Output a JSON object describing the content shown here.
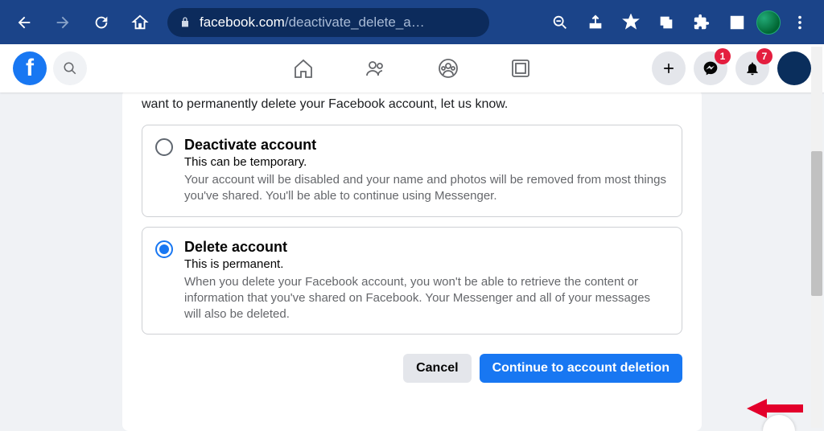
{
  "browser": {
    "url_domain": "facebook.com",
    "url_path": "/deactivate_delete_a…"
  },
  "fbnav": {
    "messenger_badge": "1",
    "notif_badge": "7"
  },
  "main": {
    "intro": "want to permanently delete your Facebook account, let us know.",
    "options": [
      {
        "title": "Deactivate account",
        "sub": "This can be temporary.",
        "desc": "Your account will be disabled and your name and photos will be removed from most things you've shared. You'll be able to continue using Messenger."
      },
      {
        "title": "Delete account",
        "sub": "This is permanent.",
        "desc": "When you delete your Facebook account, you won't be able to retrieve the content or information that you've shared on Facebook. Your Messenger and all of your messages will also be deleted."
      }
    ],
    "cancel": "Cancel",
    "continue": "Continue to account deletion"
  }
}
